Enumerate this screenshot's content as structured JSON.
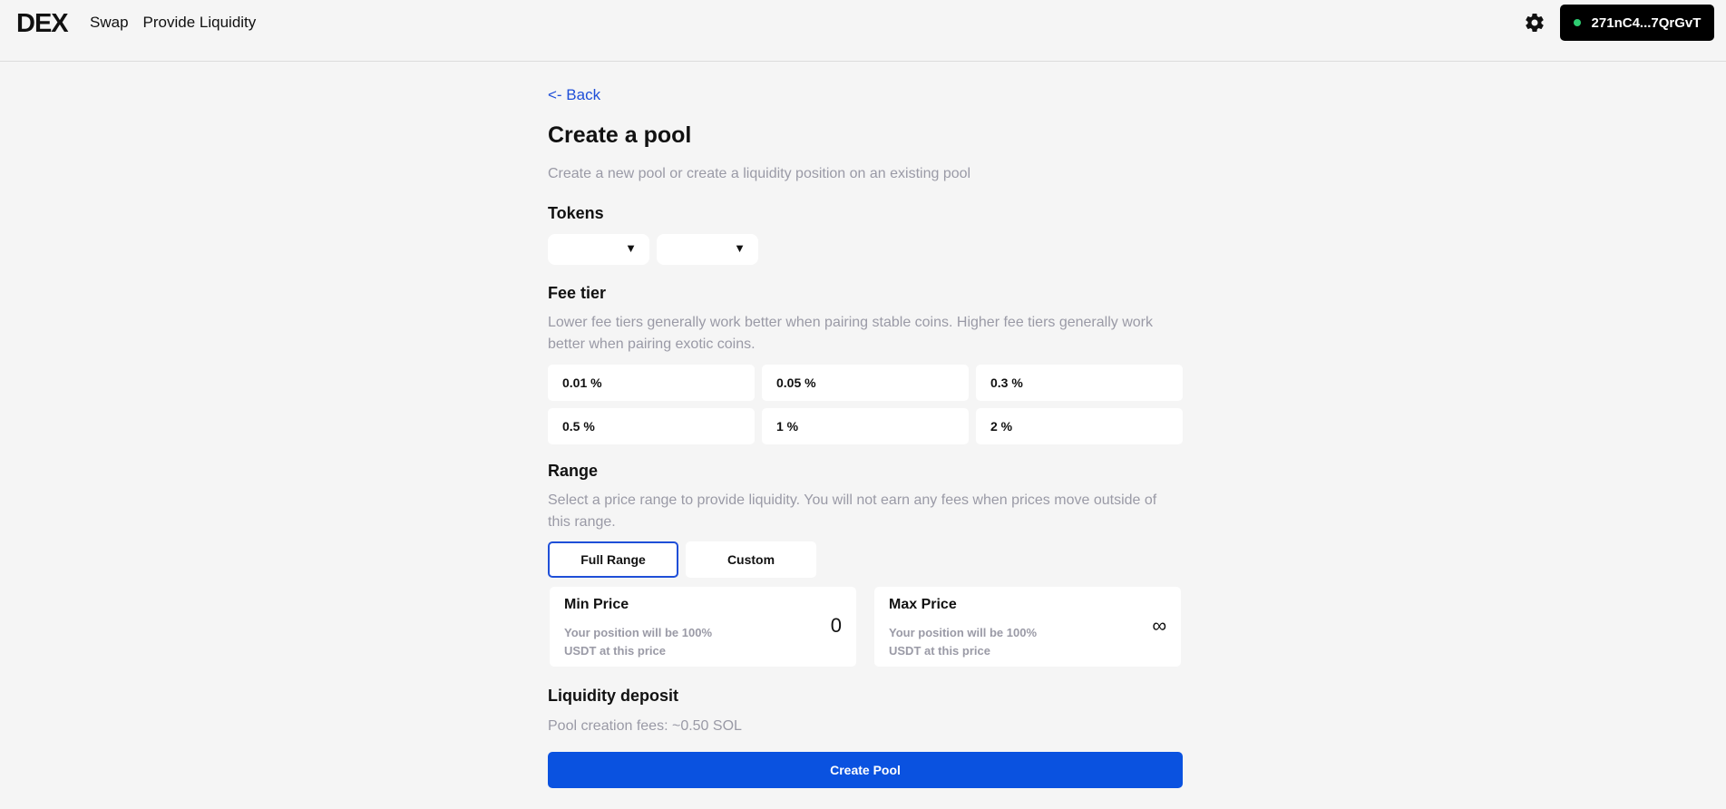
{
  "app": {
    "logo": "DEX"
  },
  "nav": {
    "items": [
      "Swap",
      "Provide Liquidity"
    ]
  },
  "header": {
    "settings_icon": "gear-icon",
    "wallet_label": "271nC4...7QrGvT",
    "wallet_status_color": "#2ecc71"
  },
  "page": {
    "back": "<- Back",
    "title": "Create a pool",
    "subtitle": "Create a new pool or create a liquidity position on an existing pool"
  },
  "tokens": {
    "heading": "Tokens",
    "selects": [
      {
        "value": "",
        "arrow": "▼"
      },
      {
        "value": "",
        "arrow": "▼"
      }
    ]
  },
  "fee_tier": {
    "heading": "Fee tier",
    "description": "Lower fee tiers generally work better when pairing stable coins. Higher fee tiers generally work better when pairing exotic coins.",
    "options": [
      "0.01 %",
      "0.05 %",
      "0.3 %",
      "0.5 %",
      "1 %",
      "2 %"
    ]
  },
  "range": {
    "heading": "Range",
    "description": "Select a price range to provide liquidity. You will not earn any fees when prices move outside of this range.",
    "buttons": [
      "Full Range",
      "Custom"
    ],
    "selected": "Full Range",
    "min": {
      "label": "Min Price",
      "note": "Your position will be 100% USDT at this price",
      "value": "0"
    },
    "max": {
      "label": "Max Price",
      "note": "Your position will be 100% USDT at this price",
      "value": "∞"
    }
  },
  "deposit": {
    "heading": "Liquidity deposit",
    "fees": "Pool creation fees: ~0.50 SOL",
    "submit": "Create Pool"
  },
  "colors": {
    "accent": "#0a52e0",
    "muted": "#9a9aa6",
    "background": "#f5f5f5"
  }
}
